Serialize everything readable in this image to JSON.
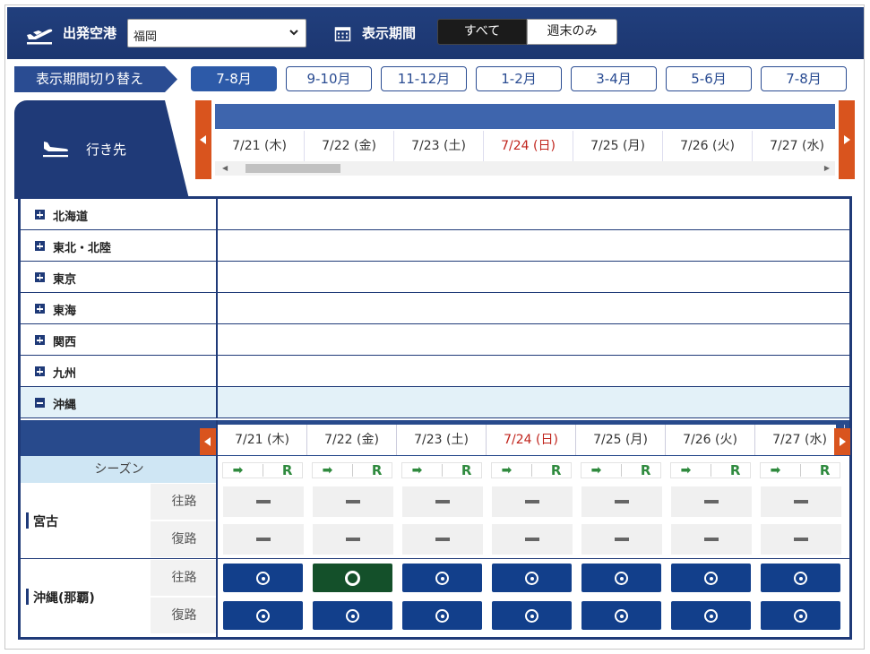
{
  "header": {
    "departure_label": "出発空港",
    "departure_value": "福岡",
    "period_label": "表示期間",
    "toggle_all": "すべて",
    "toggle_weekend": "週末のみ"
  },
  "period_switch": {
    "label": "表示期間切り替え",
    "tabs": [
      "7-8月",
      "9-10月",
      "11-12月",
      "1-2月",
      "3-4月",
      "5-6月",
      "7-8月"
    ],
    "active_index": 0
  },
  "destination": {
    "label": "行き先"
  },
  "dates": [
    {
      "label": "7/21 (木)",
      "type": "weekday"
    },
    {
      "label": "7/22 (金)",
      "type": "weekday"
    },
    {
      "label": "7/23 (土)",
      "type": "saturday"
    },
    {
      "label": "7/24 (日)",
      "type": "sunday"
    },
    {
      "label": "7/25 (月)",
      "type": "weekday"
    },
    {
      "label": "7/26 (火)",
      "type": "weekday"
    },
    {
      "label": "7/27 (水)",
      "type": "weekday"
    }
  ],
  "regions": [
    {
      "name": "北海道",
      "expanded": false
    },
    {
      "name": "東北・北陸",
      "expanded": false
    },
    {
      "name": "東京",
      "expanded": false
    },
    {
      "name": "東海",
      "expanded": false
    },
    {
      "name": "関西",
      "expanded": false
    },
    {
      "name": "九州",
      "expanded": false
    },
    {
      "name": "沖縄",
      "expanded": true
    }
  ],
  "schedule": {
    "season_label": "シーズン",
    "season_symbol_arrow": "➡",
    "season_symbol_r": "R",
    "direction_outbound": "往路",
    "direction_return": "復路",
    "routes": [
      {
        "name": "宮古",
        "outbound": [
          "none",
          "none",
          "none",
          "none",
          "none",
          "none",
          "none"
        ],
        "return": [
          "none",
          "none",
          "none",
          "none",
          "none",
          "none",
          "none"
        ]
      },
      {
        "name": "沖縄(那覇)",
        "outbound": [
          "available",
          "few",
          "available",
          "available",
          "available",
          "available",
          "available"
        ],
        "return": [
          "available",
          "available",
          "available",
          "available",
          "available",
          "available",
          "available"
        ]
      }
    ]
  },
  "colors": {
    "navy": "#1f3a78",
    "accent_orange": "#d9541e",
    "sunday_red": "#c0241c",
    "available_blue": "#123f8b",
    "few_green": "#14502a",
    "season_green": "#2f8a3e"
  }
}
